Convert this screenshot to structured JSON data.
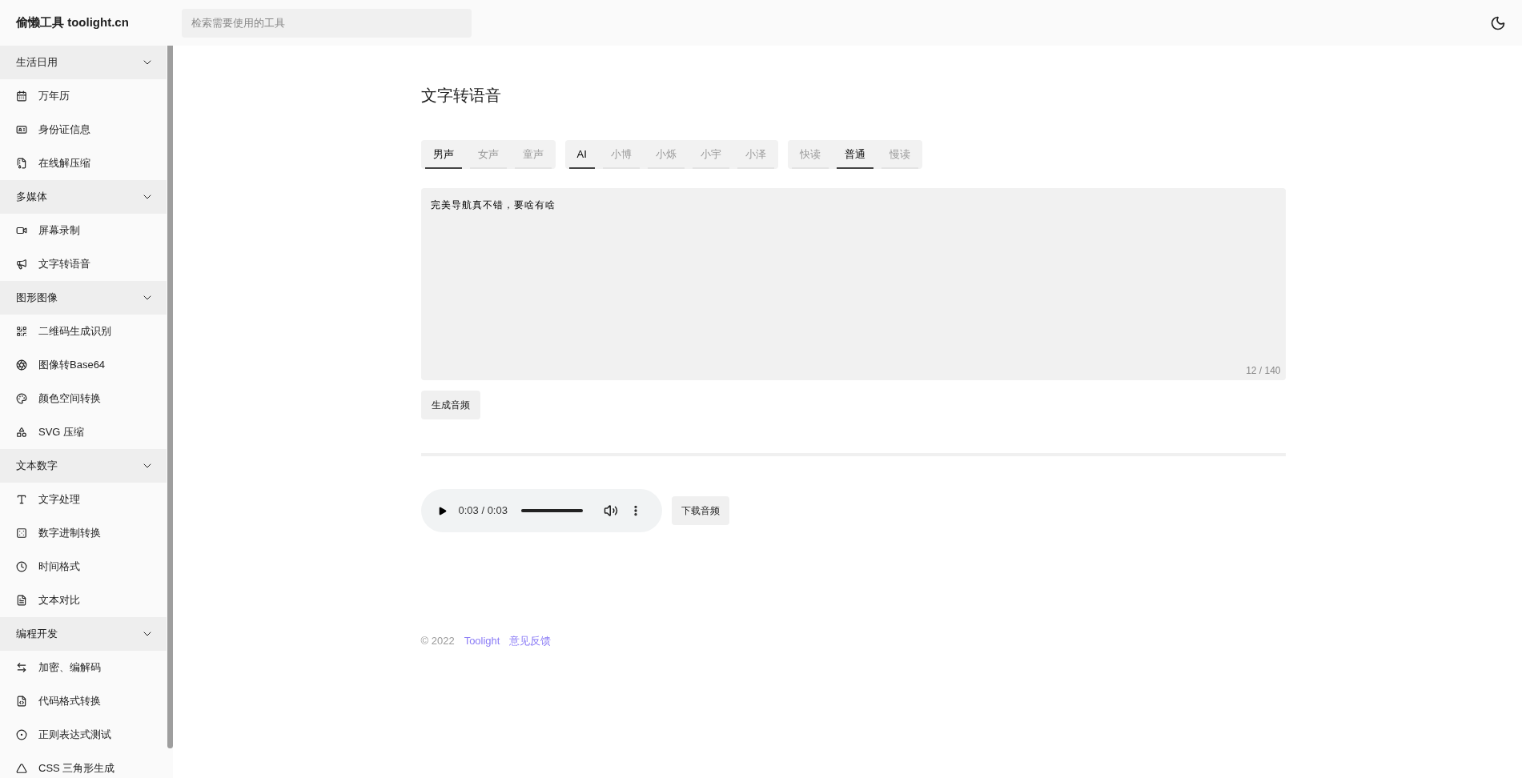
{
  "header": {
    "logo": "偷懒工具 toolight.cn",
    "search": {
      "placeholder": "检索需要使用的工具"
    }
  },
  "sidebar": {
    "groups": [
      {
        "label": "生活日用",
        "expanded": true,
        "items": [
          "万年历",
          "身份证信息",
          "在线解压缩"
        ]
      },
      {
        "label": "多媒体",
        "expanded": true,
        "items": [
          "屏幕录制",
          "文字转语音"
        ]
      },
      {
        "label": "图形图像",
        "expanded": true,
        "items": [
          "二维码生成识别",
          "图像转Base64",
          "颜色空间转换",
          "SVG 压缩"
        ]
      },
      {
        "label": "文本数字",
        "expanded": true,
        "items": [
          "文字处理",
          "数字进制转换",
          "时间格式",
          "文本对比"
        ]
      },
      {
        "label": "编程开发",
        "expanded": true,
        "items": [
          "加密、编解码",
          "代码格式转换",
          "正则表达式测试",
          "CSS 三角形生成"
        ]
      }
    ]
  },
  "main": {
    "title": "文字转语音",
    "option_groups": [
      [
        {
          "label": "男声",
          "selected": true
        },
        {
          "label": "女声",
          "selected": false
        },
        {
          "label": "童声",
          "selected": false
        }
      ],
      [
        {
          "label": "AI",
          "selected": true
        },
        {
          "label": "小博",
          "selected": false
        },
        {
          "label": "小烁",
          "selected": false
        },
        {
          "label": "小宇",
          "selected": false
        },
        {
          "label": "小泽",
          "selected": false
        }
      ],
      [
        {
          "label": "快读",
          "selected": false
        },
        {
          "label": "普通",
          "selected": true
        },
        {
          "label": "慢读",
          "selected": false
        }
      ]
    ],
    "text_input": {
      "value": "完美导航真不错，要啥有啥",
      "counter": "12 / 140"
    },
    "generate_button": "生成音频",
    "audio": {
      "time": "0:03 / 0:03",
      "level": 1
    },
    "download_button": "下载音频"
  },
  "footer": {
    "copyright": "© 2022",
    "links": [
      "Toolight",
      "意见反馈"
    ]
  }
}
